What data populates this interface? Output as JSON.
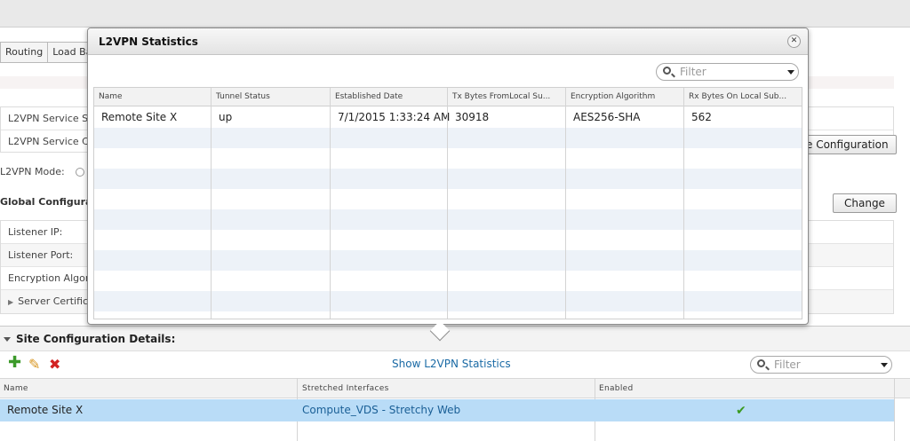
{
  "tabs": [
    "Routing",
    "Load Ba"
  ],
  "l2vpn_service": {
    "row1": "L2VPN Service S",
    "row2": "L2VPN Service C",
    "config_button": "e Configuration"
  },
  "mode_label": "L2VPN Mode:",
  "global": {
    "title": "Global Configurati",
    "change_button": "Change",
    "rows": [
      "Listener IP:",
      "Listener Port:",
      "Encryption Algori",
      "Server Certific"
    ]
  },
  "site_config": {
    "title": "Site Configuration Details:",
    "show_stats_link": "Show L2VPN Statistics",
    "filter_placeholder": "Filter",
    "columns": [
      "Name",
      "Stretched Interfaces",
      "Enabled"
    ],
    "rows": [
      {
        "name": "Remote Site X",
        "interfaces": "Compute_VDS - Stretchy Web",
        "enabled": "✔"
      }
    ]
  },
  "modal": {
    "title": "L2VPN Statistics",
    "close_glyph": "✕",
    "filter_placeholder": "Filter",
    "columns": [
      "Name",
      "Tunnel Status",
      "Established Date",
      "Tx Bytes FromLocal Su...",
      "Encryption Algorithm",
      "Rx Bytes On Local Sub..."
    ],
    "rows": [
      {
        "name": "Remote Site X",
        "tunnel_status": "up",
        "established": "7/1/2015 1:33:24 AM",
        "tx_bytes": "30918",
        "encryption": "AES256-SHA",
        "rx_bytes": "562"
      }
    ]
  },
  "colors": {
    "accent_link": "#1a6aa5",
    "selected_row": "#b9dcf7",
    "check_green": "#3a9a1f",
    "delete_red": "#d22222",
    "add_green": "#3c9a2a",
    "edit_orange": "#d8951e"
  },
  "icons": [
    "add-icon",
    "edit-icon",
    "delete-icon",
    "search-icon",
    "chevron-down-icon",
    "close-icon",
    "check-icon"
  ]
}
